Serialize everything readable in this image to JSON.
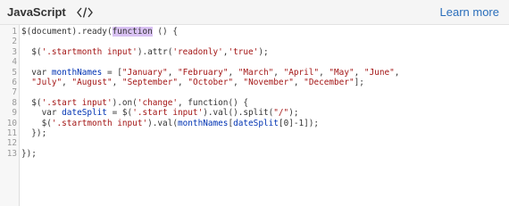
{
  "header": {
    "language": "JavaScript",
    "toggle_icon": "code-brackets-icon",
    "learn_more": "Learn more"
  },
  "colors": {
    "header_bg": "#f5f5f5",
    "link": "#2a6ebb",
    "string": "#a31515",
    "variable": "#0033b3",
    "highlight": "#d9c2f3"
  },
  "code": {
    "line_numbers": [
      "1",
      "2",
      "3",
      "4",
      "5",
      "6",
      "7",
      "8",
      "9",
      "10",
      "11",
      "12",
      "13"
    ],
    "lines": [
      [
        {
          "t": "$(document).ready("
        },
        {
          "t": "function",
          "c": "hl"
        },
        {
          "t": " () {"
        }
      ],
      [],
      [
        {
          "t": "  $("
        },
        {
          "t": "'.startmonth input'",
          "c": "str"
        },
        {
          "t": ").attr("
        },
        {
          "t": "'readonly'",
          "c": "str"
        },
        {
          "t": ","
        },
        {
          "t": "'true'",
          "c": "str"
        },
        {
          "t": ");"
        }
      ],
      [],
      [
        {
          "t": "  var "
        },
        {
          "t": "monthNames",
          "c": "var"
        },
        {
          "t": " = ["
        },
        {
          "t": "\"January\"",
          "c": "str"
        },
        {
          "t": ", "
        },
        {
          "t": "\"February\"",
          "c": "str"
        },
        {
          "t": ", "
        },
        {
          "t": "\"March\"",
          "c": "str"
        },
        {
          "t": ", "
        },
        {
          "t": "\"April\"",
          "c": "str"
        },
        {
          "t": ", "
        },
        {
          "t": "\"May\"",
          "c": "str"
        },
        {
          "t": ", "
        },
        {
          "t": "\"June\"",
          "c": "str"
        },
        {
          "t": ","
        }
      ],
      [
        {
          "t": "  "
        },
        {
          "t": "\"July\"",
          "c": "str"
        },
        {
          "t": ", "
        },
        {
          "t": "\"August\"",
          "c": "str"
        },
        {
          "t": ", "
        },
        {
          "t": "\"September\"",
          "c": "str"
        },
        {
          "t": ", "
        },
        {
          "t": "\"October\"",
          "c": "str"
        },
        {
          "t": ", "
        },
        {
          "t": "\"November\"",
          "c": "str"
        },
        {
          "t": ", "
        },
        {
          "t": "\"December\"",
          "c": "str"
        },
        {
          "t": "];"
        }
      ],
      [],
      [
        {
          "t": "  $("
        },
        {
          "t": "'.start input'",
          "c": "str"
        },
        {
          "t": ").on("
        },
        {
          "t": "'change'",
          "c": "str"
        },
        {
          "t": ", function() {"
        }
      ],
      [
        {
          "t": "    var "
        },
        {
          "t": "dateSplit",
          "c": "var"
        },
        {
          "t": " = $("
        },
        {
          "t": "'.start input'",
          "c": "str"
        },
        {
          "t": ").val().split("
        },
        {
          "t": "\"/\"",
          "c": "str"
        },
        {
          "t": ");"
        }
      ],
      [
        {
          "t": "    $("
        },
        {
          "t": "'.startmonth input'",
          "c": "str"
        },
        {
          "t": ").val("
        },
        {
          "t": "monthNames",
          "c": "var"
        },
        {
          "t": "["
        },
        {
          "t": "dateSplit",
          "c": "var"
        },
        {
          "t": "[0]-1]);"
        }
      ],
      [
        {
          "t": "  });"
        }
      ],
      [],
      [
        {
          "t": "});"
        }
      ]
    ]
  }
}
